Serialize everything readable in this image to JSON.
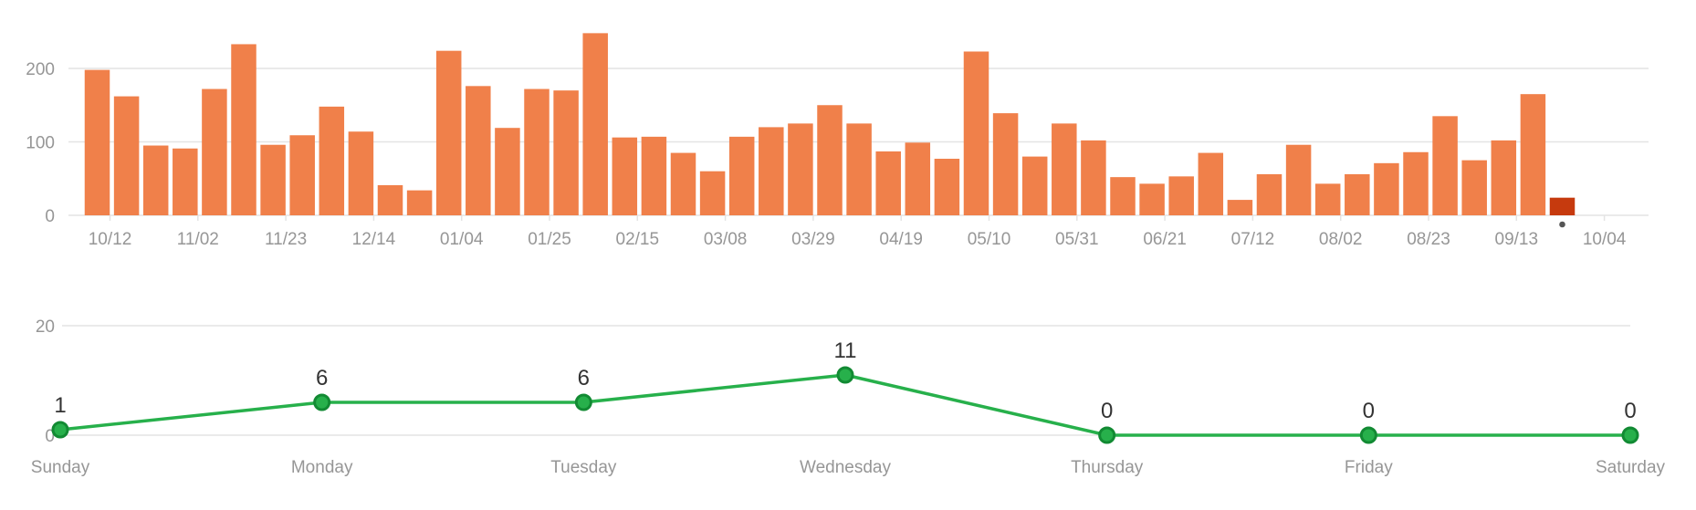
{
  "colors": {
    "bar": "#f0804a",
    "bar_current": "#c63a0e",
    "line": "#27b04b",
    "point_fill": "#27b04b",
    "point_stroke": "#128a33",
    "grid": "#e4e4e4",
    "tick": "#969696",
    "label": "#333333",
    "marker": "#555555"
  },
  "chart_data": [
    {
      "type": "bar",
      "title": "",
      "xlabel": "",
      "ylabel": "",
      "ylim": [
        0,
        260
      ],
      "yticks": [
        0,
        100,
        200
      ],
      "grid": true,
      "x_tick_labels": [
        "10/12",
        "11/02",
        "11/23",
        "12/14",
        "01/04",
        "01/25",
        "02/15",
        "03/08",
        "03/29",
        "04/19",
        "05/10",
        "05/31",
        "06/21",
        "07/12",
        "08/02",
        "08/23",
        "09/13",
        "10/04"
      ],
      "values": [
        198,
        162,
        95,
        91,
        172,
        233,
        96,
        109,
        148,
        114,
        41,
        34,
        224,
        176,
        119,
        172,
        170,
        248,
        106,
        107,
        85,
        60,
        107,
        120,
        125,
        150,
        125,
        87,
        99,
        77,
        223,
        139,
        80,
        125,
        102,
        52,
        43,
        53,
        85,
        21,
        56,
        96,
        43,
        56,
        71,
        86,
        135,
        75,
        102,
        165,
        24
      ],
      "current_index": 50
    },
    {
      "type": "line",
      "title": "",
      "xlabel": "",
      "ylabel": "",
      "ylim": [
        0,
        20
      ],
      "yticks": [
        0,
        20
      ],
      "grid": true,
      "categories": [
        "Sunday",
        "Monday",
        "Tuesday",
        "Wednesday",
        "Thursday",
        "Friday",
        "Saturday"
      ],
      "values": [
        1,
        6,
        6,
        11,
        0,
        0,
        0
      ],
      "data_labels": [
        "1",
        "6",
        "6",
        "11",
        "0",
        "0",
        "0"
      ]
    }
  ]
}
